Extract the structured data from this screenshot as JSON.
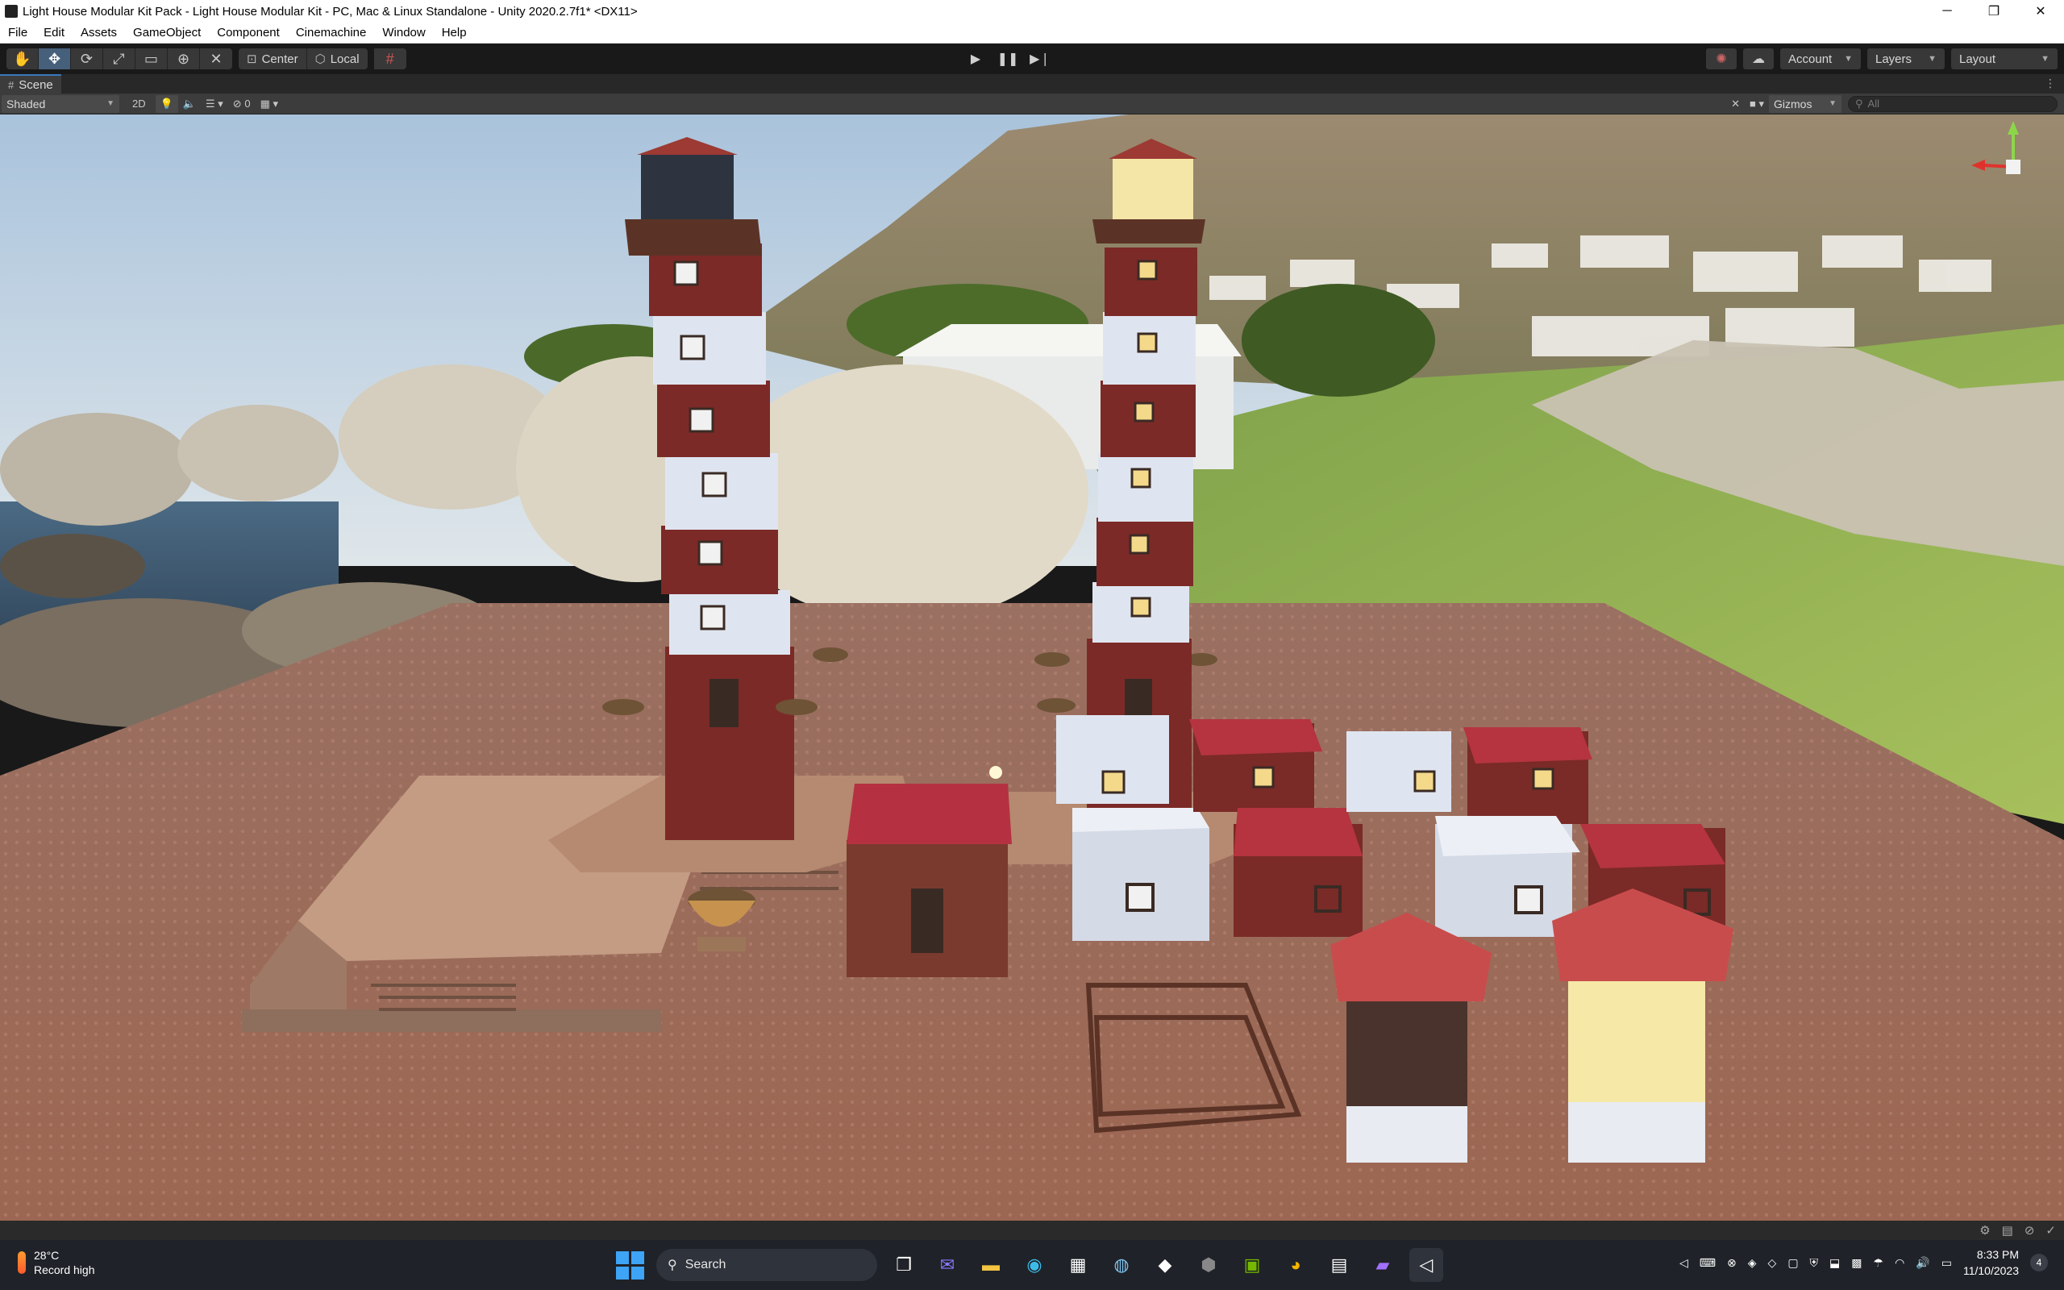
{
  "window": {
    "title": "Light House Modular Kit Pack - Light House Modular Kit - PC, Mac & Linux Standalone - Unity 2020.2.7f1* <DX11>",
    "minimize": "─",
    "maximize": "❐",
    "close": "✕"
  },
  "menu": [
    "File",
    "Edit",
    "Assets",
    "GameObject",
    "Component",
    "Cinemachine",
    "Window",
    "Help"
  ],
  "toolbar": {
    "pivot_label": "Center",
    "space_label": "Local",
    "account_label": "Account",
    "layers_label": "Layers",
    "layout_label": "Layout"
  },
  "scene": {
    "tab_label": "Scene",
    "draw_mode": "Shaded",
    "mode_2d": "2D",
    "hidden_count": "0",
    "gizmos_label": "Gizmos",
    "search_placeholder": "All"
  },
  "taskbar": {
    "temperature": "28°C",
    "weather_text": "Record high",
    "search_label": "Search",
    "time": "8:33 PM",
    "date": "11/10/2023",
    "notification_count": "4"
  },
  "colors": {
    "editor_bg": "#191919",
    "active_tool": "#46607c",
    "ground": "#9b6d5a",
    "lighthouse_red": "#7c2a27",
    "lighthouse_white": "#dde3ee"
  }
}
